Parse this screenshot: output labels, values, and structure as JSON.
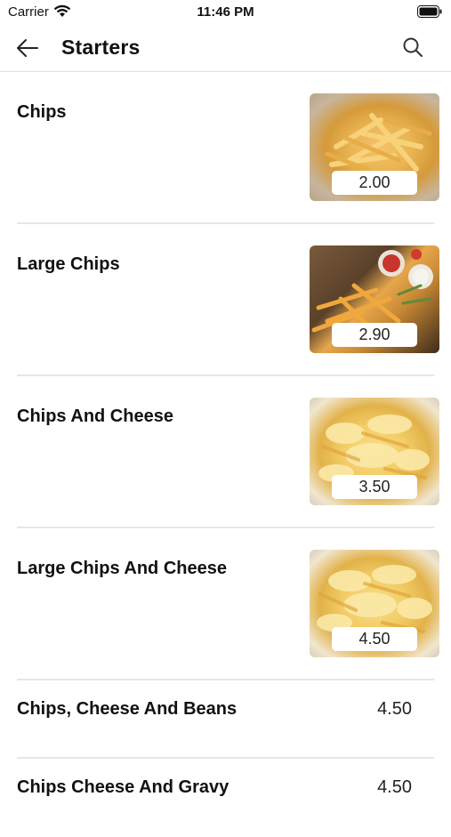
{
  "status_bar": {
    "carrier": "Carrier",
    "time": "11:46 PM",
    "wifi_icon": "wifi-icon",
    "battery_icon": "battery-full-icon"
  },
  "nav": {
    "title": "Starters",
    "back_icon": "arrow-left-icon",
    "search_icon": "search-icon"
  },
  "menu_items": [
    {
      "name": "Chips",
      "price": "2.00",
      "image": "fries-photo"
    },
    {
      "name": "Large Chips",
      "price": "2.90",
      "image": "fries-with-dips-photo"
    },
    {
      "name": "Chips And Cheese",
      "price": "3.50",
      "image": "cheesy-fries-photo"
    },
    {
      "name": "Large Chips And Cheese",
      "price": "4.50",
      "image": "cheesy-fries-photo"
    },
    {
      "name": "Chips, Cheese And Beans",
      "price": "4.50"
    },
    {
      "name": "Chips Cheese And Gravy",
      "price": "4.50"
    }
  ],
  "colors": {
    "background": "#ffffff",
    "text": "#111111",
    "divider": "#e6e6e6"
  }
}
